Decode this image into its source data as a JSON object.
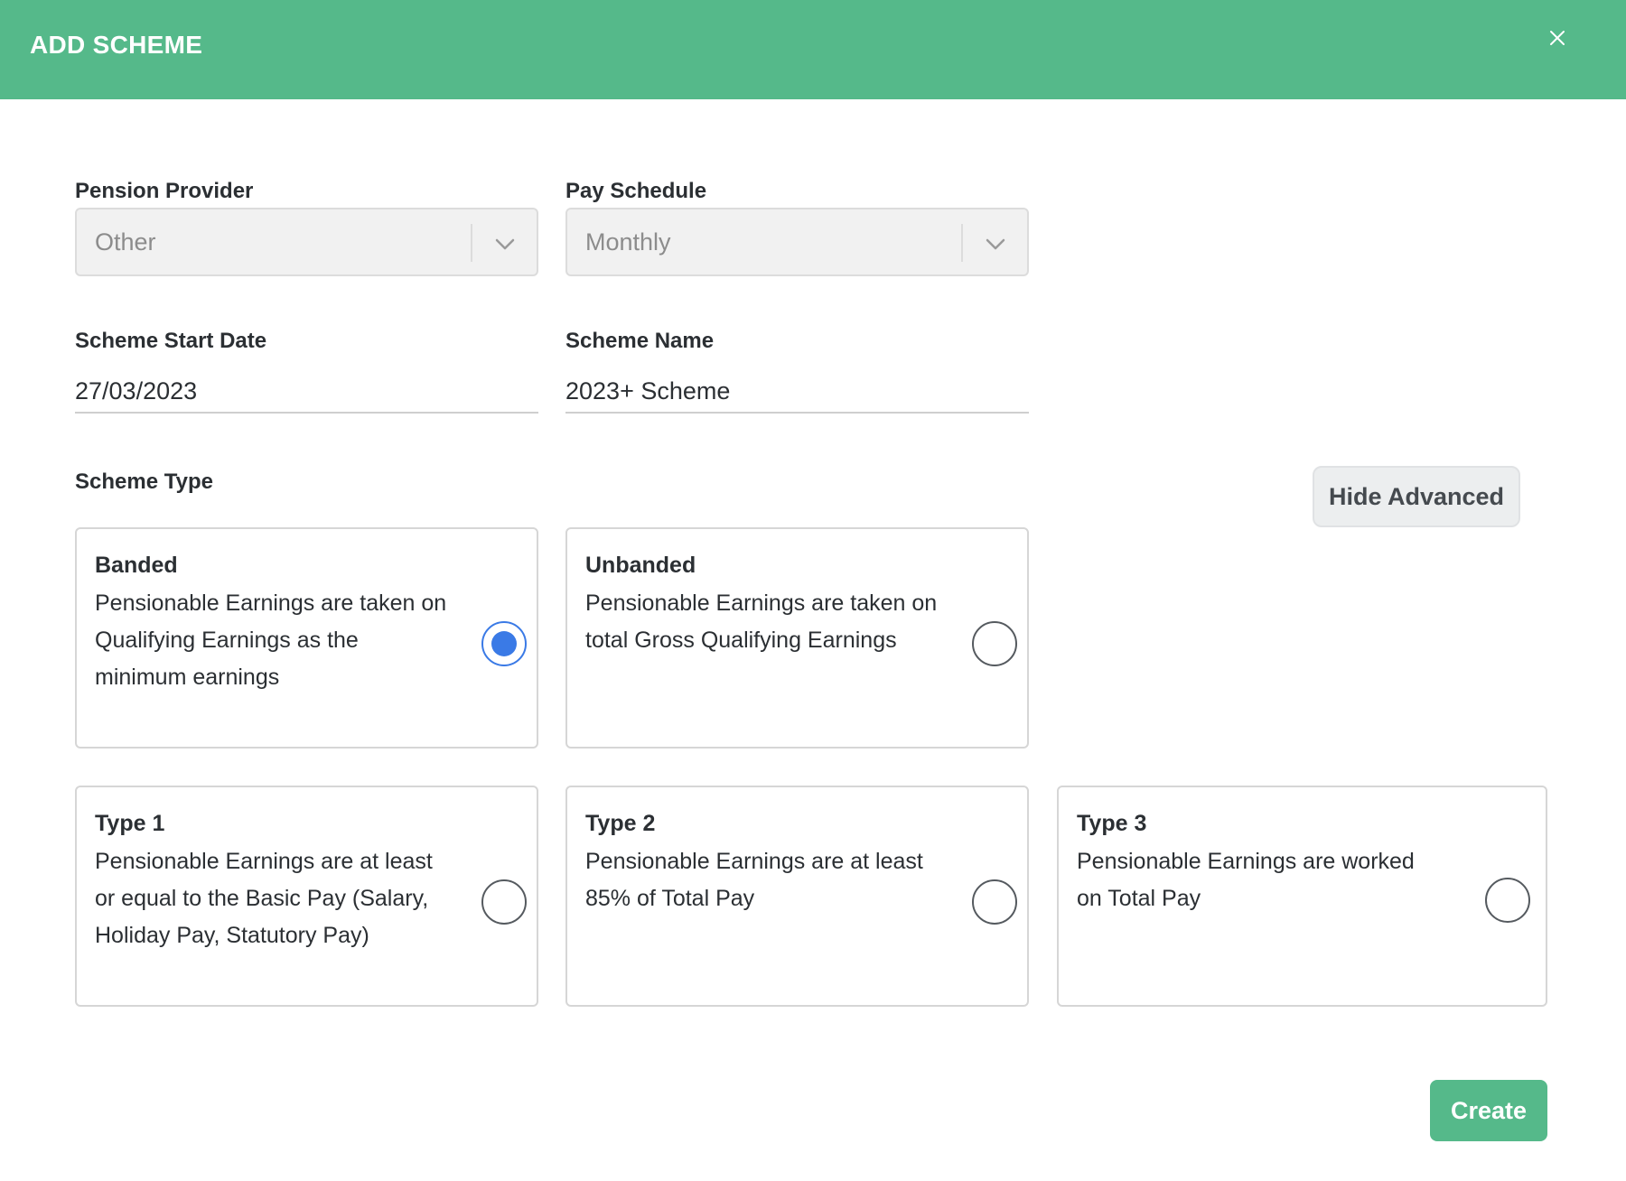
{
  "header": {
    "title": "ADD SCHEME",
    "close_icon": "close-icon"
  },
  "form": {
    "pension_provider": {
      "label": "Pension Provider",
      "value": "Other"
    },
    "pay_schedule": {
      "label": "Pay Schedule",
      "value": "Monthly"
    },
    "scheme_start_date": {
      "label": "Scheme Start Date",
      "value": "27/03/2023"
    },
    "scheme_name": {
      "label": "Scheme Name",
      "value": "2023+ Scheme"
    },
    "scheme_type": {
      "label": "Scheme Type",
      "hide_advanced_label": "Hide Advanced",
      "options": [
        {
          "title": "Banded",
          "description": "Pensionable Earnings are taken on Qualifying Earnings as the minimum earnings",
          "selected": true
        },
        {
          "title": "Unbanded",
          "description": "Pensionable Earnings are taken on total Gross Qualifying Earnings",
          "selected": false
        },
        {
          "title": "Type 1",
          "description": "Pensionable Earnings are at least or equal to the Basic Pay (Salary, Holiday Pay, Statutory Pay)",
          "selected": false
        },
        {
          "title": "Type 2",
          "description": "Pensionable Earnings are at least 85% of Total Pay",
          "selected": false
        },
        {
          "title": "Type 3",
          "description": "Pensionable Earnings are worked on Total Pay",
          "selected": false
        }
      ]
    }
  },
  "actions": {
    "create_label": "Create"
  },
  "colors": {
    "header_green": "#55b98a",
    "radio_blue": "#3a7ae6",
    "create_green": "#55b98a"
  }
}
